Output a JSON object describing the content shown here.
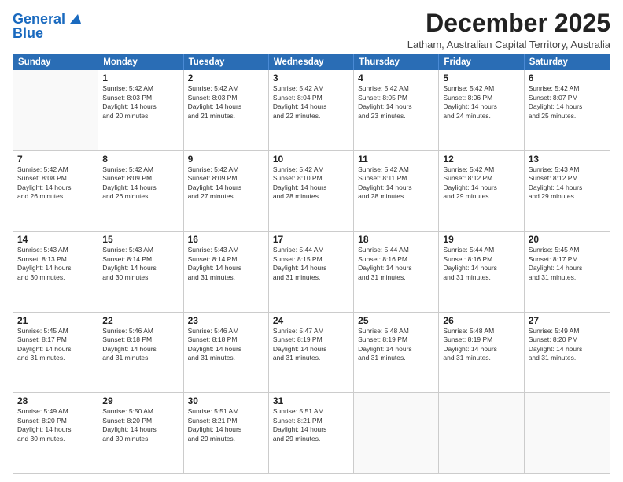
{
  "logo": {
    "line1": "General",
    "line2": "Blue"
  },
  "header": {
    "month": "December 2025",
    "location": "Latham, Australian Capital Territory, Australia"
  },
  "days": [
    "Sunday",
    "Monday",
    "Tuesday",
    "Wednesday",
    "Thursday",
    "Friday",
    "Saturday"
  ],
  "rows": [
    [
      {
        "num": "",
        "lines": []
      },
      {
        "num": "1",
        "lines": [
          "Sunrise: 5:42 AM",
          "Sunset: 8:03 PM",
          "Daylight: 14 hours",
          "and 20 minutes."
        ]
      },
      {
        "num": "2",
        "lines": [
          "Sunrise: 5:42 AM",
          "Sunset: 8:03 PM",
          "Daylight: 14 hours",
          "and 21 minutes."
        ]
      },
      {
        "num": "3",
        "lines": [
          "Sunrise: 5:42 AM",
          "Sunset: 8:04 PM",
          "Daylight: 14 hours",
          "and 22 minutes."
        ]
      },
      {
        "num": "4",
        "lines": [
          "Sunrise: 5:42 AM",
          "Sunset: 8:05 PM",
          "Daylight: 14 hours",
          "and 23 minutes."
        ]
      },
      {
        "num": "5",
        "lines": [
          "Sunrise: 5:42 AM",
          "Sunset: 8:06 PM",
          "Daylight: 14 hours",
          "and 24 minutes."
        ]
      },
      {
        "num": "6",
        "lines": [
          "Sunrise: 5:42 AM",
          "Sunset: 8:07 PM",
          "Daylight: 14 hours",
          "and 25 minutes."
        ]
      }
    ],
    [
      {
        "num": "7",
        "lines": [
          "Sunrise: 5:42 AM",
          "Sunset: 8:08 PM",
          "Daylight: 14 hours",
          "and 26 minutes."
        ]
      },
      {
        "num": "8",
        "lines": [
          "Sunrise: 5:42 AM",
          "Sunset: 8:09 PM",
          "Daylight: 14 hours",
          "and 26 minutes."
        ]
      },
      {
        "num": "9",
        "lines": [
          "Sunrise: 5:42 AM",
          "Sunset: 8:09 PM",
          "Daylight: 14 hours",
          "and 27 minutes."
        ]
      },
      {
        "num": "10",
        "lines": [
          "Sunrise: 5:42 AM",
          "Sunset: 8:10 PM",
          "Daylight: 14 hours",
          "and 28 minutes."
        ]
      },
      {
        "num": "11",
        "lines": [
          "Sunrise: 5:42 AM",
          "Sunset: 8:11 PM",
          "Daylight: 14 hours",
          "and 28 minutes."
        ]
      },
      {
        "num": "12",
        "lines": [
          "Sunrise: 5:42 AM",
          "Sunset: 8:12 PM",
          "Daylight: 14 hours",
          "and 29 minutes."
        ]
      },
      {
        "num": "13",
        "lines": [
          "Sunrise: 5:43 AM",
          "Sunset: 8:12 PM",
          "Daylight: 14 hours",
          "and 29 minutes."
        ]
      }
    ],
    [
      {
        "num": "14",
        "lines": [
          "Sunrise: 5:43 AM",
          "Sunset: 8:13 PM",
          "Daylight: 14 hours",
          "and 30 minutes."
        ]
      },
      {
        "num": "15",
        "lines": [
          "Sunrise: 5:43 AM",
          "Sunset: 8:14 PM",
          "Daylight: 14 hours",
          "and 30 minutes."
        ]
      },
      {
        "num": "16",
        "lines": [
          "Sunrise: 5:43 AM",
          "Sunset: 8:14 PM",
          "Daylight: 14 hours",
          "and 31 minutes."
        ]
      },
      {
        "num": "17",
        "lines": [
          "Sunrise: 5:44 AM",
          "Sunset: 8:15 PM",
          "Daylight: 14 hours",
          "and 31 minutes."
        ]
      },
      {
        "num": "18",
        "lines": [
          "Sunrise: 5:44 AM",
          "Sunset: 8:16 PM",
          "Daylight: 14 hours",
          "and 31 minutes."
        ]
      },
      {
        "num": "19",
        "lines": [
          "Sunrise: 5:44 AM",
          "Sunset: 8:16 PM",
          "Daylight: 14 hours",
          "and 31 minutes."
        ]
      },
      {
        "num": "20",
        "lines": [
          "Sunrise: 5:45 AM",
          "Sunset: 8:17 PM",
          "Daylight: 14 hours",
          "and 31 minutes."
        ]
      }
    ],
    [
      {
        "num": "21",
        "lines": [
          "Sunrise: 5:45 AM",
          "Sunset: 8:17 PM",
          "Daylight: 14 hours",
          "and 31 minutes."
        ]
      },
      {
        "num": "22",
        "lines": [
          "Sunrise: 5:46 AM",
          "Sunset: 8:18 PM",
          "Daylight: 14 hours",
          "and 31 minutes."
        ]
      },
      {
        "num": "23",
        "lines": [
          "Sunrise: 5:46 AM",
          "Sunset: 8:18 PM",
          "Daylight: 14 hours",
          "and 31 minutes."
        ]
      },
      {
        "num": "24",
        "lines": [
          "Sunrise: 5:47 AM",
          "Sunset: 8:19 PM",
          "Daylight: 14 hours",
          "and 31 minutes."
        ]
      },
      {
        "num": "25",
        "lines": [
          "Sunrise: 5:48 AM",
          "Sunset: 8:19 PM",
          "Daylight: 14 hours",
          "and 31 minutes."
        ]
      },
      {
        "num": "26",
        "lines": [
          "Sunrise: 5:48 AM",
          "Sunset: 8:19 PM",
          "Daylight: 14 hours",
          "and 31 minutes."
        ]
      },
      {
        "num": "27",
        "lines": [
          "Sunrise: 5:49 AM",
          "Sunset: 8:20 PM",
          "Daylight: 14 hours",
          "and 31 minutes."
        ]
      }
    ],
    [
      {
        "num": "28",
        "lines": [
          "Sunrise: 5:49 AM",
          "Sunset: 8:20 PM",
          "Daylight: 14 hours",
          "and 30 minutes."
        ]
      },
      {
        "num": "29",
        "lines": [
          "Sunrise: 5:50 AM",
          "Sunset: 8:20 PM",
          "Daylight: 14 hours",
          "and 30 minutes."
        ]
      },
      {
        "num": "30",
        "lines": [
          "Sunrise: 5:51 AM",
          "Sunset: 8:21 PM",
          "Daylight: 14 hours",
          "and 29 minutes."
        ]
      },
      {
        "num": "31",
        "lines": [
          "Sunrise: 5:51 AM",
          "Sunset: 8:21 PM",
          "Daylight: 14 hours",
          "and 29 minutes."
        ]
      },
      {
        "num": "",
        "lines": []
      },
      {
        "num": "",
        "lines": []
      },
      {
        "num": "",
        "lines": []
      }
    ]
  ]
}
